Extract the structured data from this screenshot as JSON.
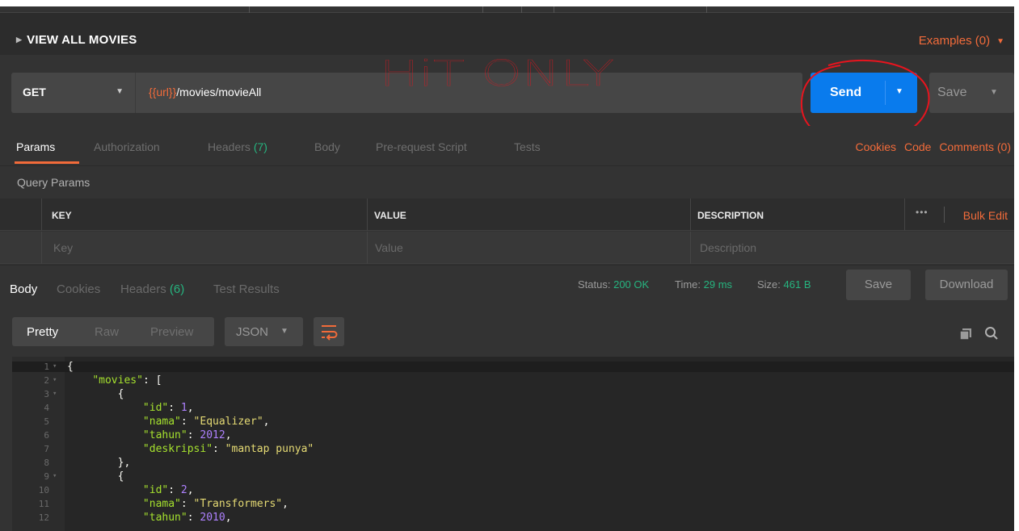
{
  "titlebar": {
    "title": "VIEW ALL MOVIES",
    "examples": "Examples (0)"
  },
  "request": {
    "method": "GET",
    "url_var": "{{url}}",
    "url_path": "/movies/movieAll",
    "send_label": "Send",
    "save_label": "Save"
  },
  "annotation": {
    "text": "HiT ONLY",
    "color": "#e8141e"
  },
  "tabs": [
    {
      "label": "Params",
      "count": ""
    },
    {
      "label": "Authorization",
      "count": ""
    },
    {
      "label": "Headers",
      "count": "(7)"
    },
    {
      "label": "Body",
      "count": ""
    },
    {
      "label": "Pre-request Script",
      "count": ""
    },
    {
      "label": "Tests",
      "count": ""
    }
  ],
  "links": {
    "cookies": "Cookies",
    "code": "Code",
    "comments": "Comments (0)"
  },
  "query": {
    "title": "Query Params",
    "headers": {
      "key": "KEY",
      "value": "VALUE",
      "description": "DESCRIPTION"
    },
    "placeholders": {
      "key": "Key",
      "value": "Value",
      "description": "Description"
    },
    "dots": "•••",
    "bulk_edit": "Bulk Edit"
  },
  "response": {
    "tabs": [
      {
        "label": "Body",
        "count": ""
      },
      {
        "label": "Cookies",
        "count": ""
      },
      {
        "label": "Headers",
        "count": "(6)"
      },
      {
        "label": "Test Results",
        "count": ""
      }
    ],
    "status_label": "Status:",
    "status_value": "200 OK",
    "time_label": "Time:",
    "time_value": "29 ms",
    "size_label": "Size:",
    "size_value": "461 B",
    "save_label": "Save",
    "download_label": "Download"
  },
  "body_toolbar": {
    "views": [
      "Pretty",
      "Raw",
      "Preview"
    ],
    "format": "JSON"
  },
  "code_lines": [
    {
      "n": "1",
      "fold": true,
      "html": "<span class='p'>{</span>"
    },
    {
      "n": "2",
      "fold": true,
      "html": "    <span class='k'>\"movies\"</span><span class='p'>: [</span>"
    },
    {
      "n": "3",
      "fold": true,
      "html": "        <span class='p'>{</span>"
    },
    {
      "n": "4",
      "fold": false,
      "html": "            <span class='k'>\"id\"</span><span class='p'>: </span><span class='n'>1</span><span class='p'>,</span>"
    },
    {
      "n": "5",
      "fold": false,
      "html": "            <span class='k'>\"nama\"</span><span class='p'>: </span><span class='s'>\"Equalizer\"</span><span class='p'>,</span>"
    },
    {
      "n": "6",
      "fold": false,
      "html": "            <span class='k'>\"tahun\"</span><span class='p'>: </span><span class='n'>2012</span><span class='p'>,</span>"
    },
    {
      "n": "7",
      "fold": false,
      "html": "            <span class='k'>\"deskripsi\"</span><span class='p'>: </span><span class='s'>\"mantap punya\"</span>"
    },
    {
      "n": "8",
      "fold": false,
      "html": "        <span class='p'>},</span>"
    },
    {
      "n": "9",
      "fold": true,
      "html": "        <span class='p'>{</span>"
    },
    {
      "n": "10",
      "fold": false,
      "html": "            <span class='k'>\"id\"</span><span class='p'>: </span><span class='n'>2</span><span class='p'>,</span>"
    },
    {
      "n": "11",
      "fold": false,
      "html": "            <span class='k'>\"nama\"</span><span class='p'>: </span><span class='s'>\"Transformers\"</span><span class='p'>,</span>"
    },
    {
      "n": "12",
      "fold": false,
      "html": "            <span class='k'>\"tahun\"</span><span class='p'>: </span><span class='n'>2010</span><span class='p'>,</span>"
    }
  ],
  "colors": {
    "accent": "#f26b3a",
    "send": "#097bed",
    "success": "#26b47f"
  }
}
